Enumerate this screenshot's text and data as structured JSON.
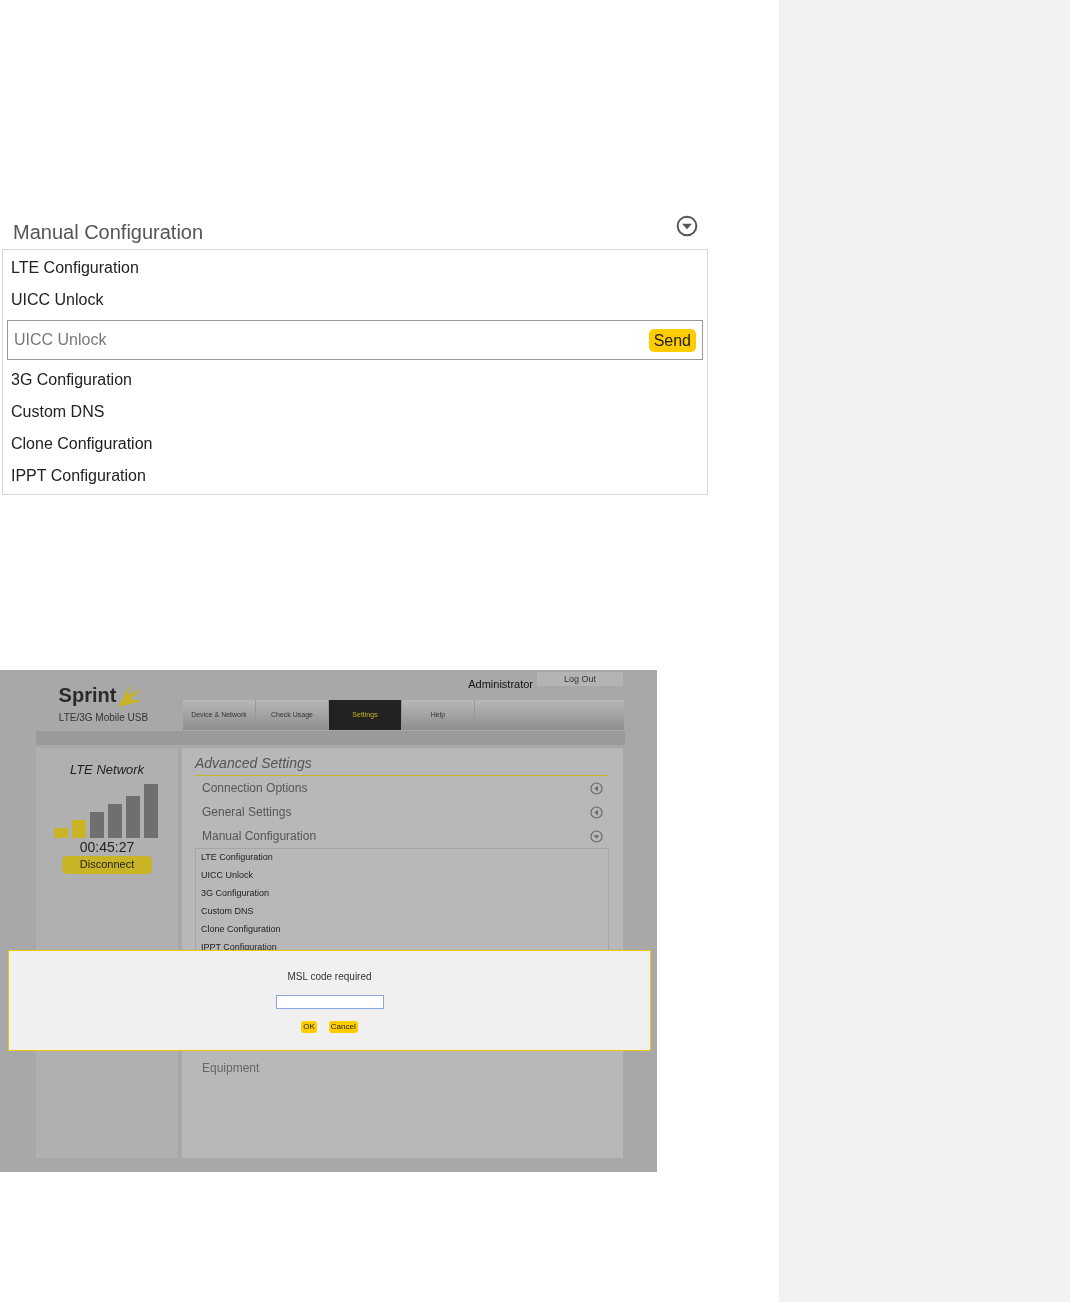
{
  "top_panel": {
    "title": "Manual Configuration",
    "expanded": true,
    "items": [
      {
        "kind": "link",
        "label": "LTE Configuration"
      },
      {
        "kind": "link",
        "label": "UICC Unlock"
      },
      {
        "kind": "field",
        "placeholder": "UICC Unlock",
        "button": "Send"
      },
      {
        "kind": "link",
        "label": "3G Configuration"
      },
      {
        "kind": "link",
        "label": "Custom DNS"
      },
      {
        "kind": "link",
        "label": "Clone Configuration"
      },
      {
        "kind": "link",
        "label": "IPPT Configuration"
      }
    ]
  },
  "device_page": {
    "logo": "Sprint",
    "subtitle": "LTE/3G Mobile USB",
    "user": "Administrator",
    "logout": "Log Out",
    "tabs": [
      {
        "label": "Device & Network",
        "selected": false
      },
      {
        "label": "Check Usage",
        "selected": false
      },
      {
        "label": "Settings",
        "selected": true
      },
      {
        "label": "Help",
        "selected": false
      }
    ],
    "network": {
      "title": "LTE Network",
      "timer": "00:45:27",
      "button": "Disconnect"
    },
    "section_title": "Advanced Settings",
    "sections": [
      {
        "title": "Connection Options",
        "expanded": false
      },
      {
        "title": "General Settings",
        "expanded": false
      },
      {
        "title": "Manual Configuration",
        "expanded": true,
        "items": [
          "LTE Configuration",
          "UICC Unlock",
          "3G Configuration",
          "Custom DNS",
          "Clone Configuration",
          "IPPT Configuration"
        ]
      }
    ],
    "hidden_section": "Equipment",
    "dialog": {
      "message": "MSL code required",
      "buttons": [
        "OK",
        "Cancel"
      ]
    }
  }
}
